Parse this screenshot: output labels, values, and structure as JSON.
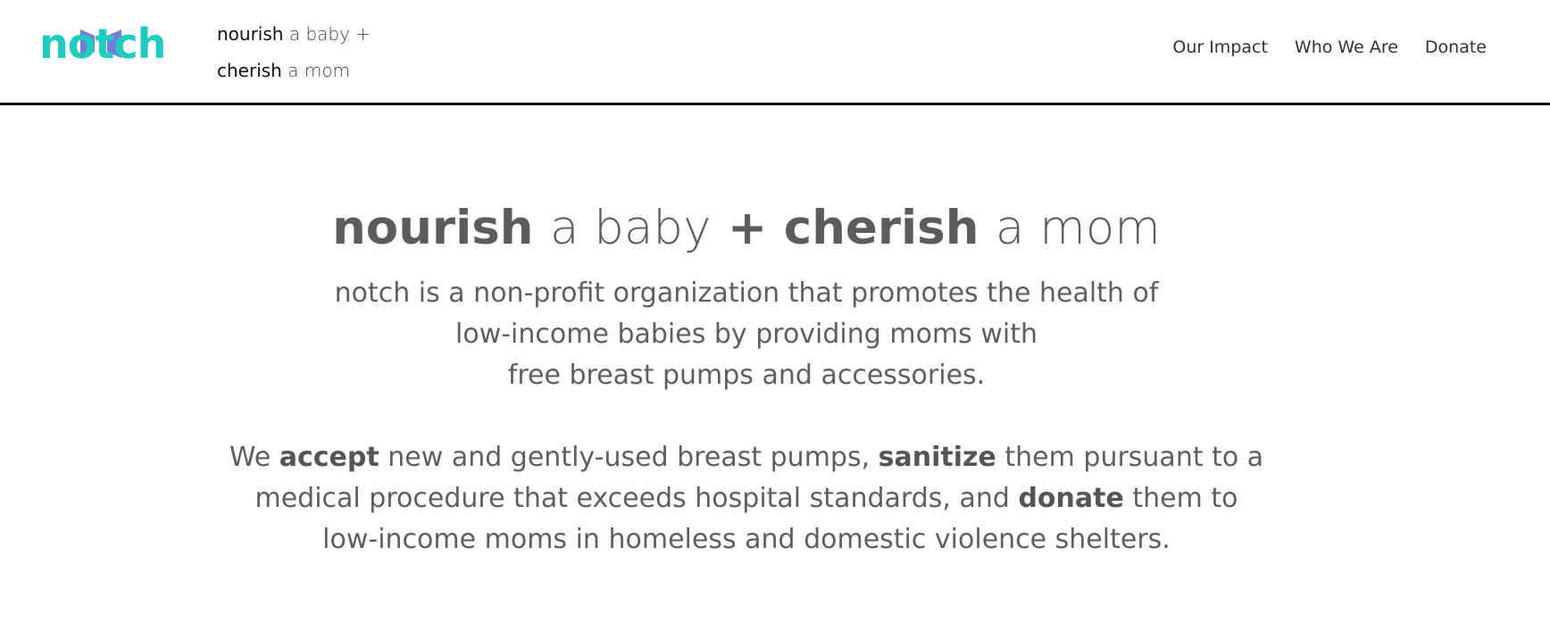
{
  "header": {
    "logo": {
      "text": "notch",
      "mark_colors": [
        "#20ccc0",
        "#6f73d6"
      ]
    },
    "tagline": {
      "line1_strong": "nourish",
      "line1_light": "a baby +",
      "line2_strong": "cherish",
      "line2_light": "a mom"
    },
    "nav": {
      "items": [
        {
          "label": "Our Impact"
        },
        {
          "label": "Who We Are"
        },
        {
          "label": "Donate"
        }
      ]
    }
  },
  "main": {
    "hero": {
      "part1": "nourish",
      "part2": "a baby",
      "plus": "+",
      "part3": "cherish",
      "part4": "a mom"
    },
    "intro": {
      "lines": [
        "notch is a non-profit organization that promotes the health of",
        "low-income babies by providing moms with",
        "free breast pumps and accessories."
      ]
    },
    "mission": {
      "l1_a": "We",
      "l1_b": "accept",
      "l1_c": "new and gently-used breast pumps,",
      "l1_d": "sanitize",
      "l1_e": "them pursuant to a",
      "l2_a": "medical procedure that exceeds hospital standards, and",
      "l2_b": "donate",
      "l2_c": "them to",
      "l3": "low-income moms in homeless and domestic violence shelters."
    }
  },
  "colors": {
    "brand_teal": "#20ccc0",
    "brand_purple": "#6f73d6",
    "body_text": "#5f5f5f",
    "divider": "#111111"
  }
}
